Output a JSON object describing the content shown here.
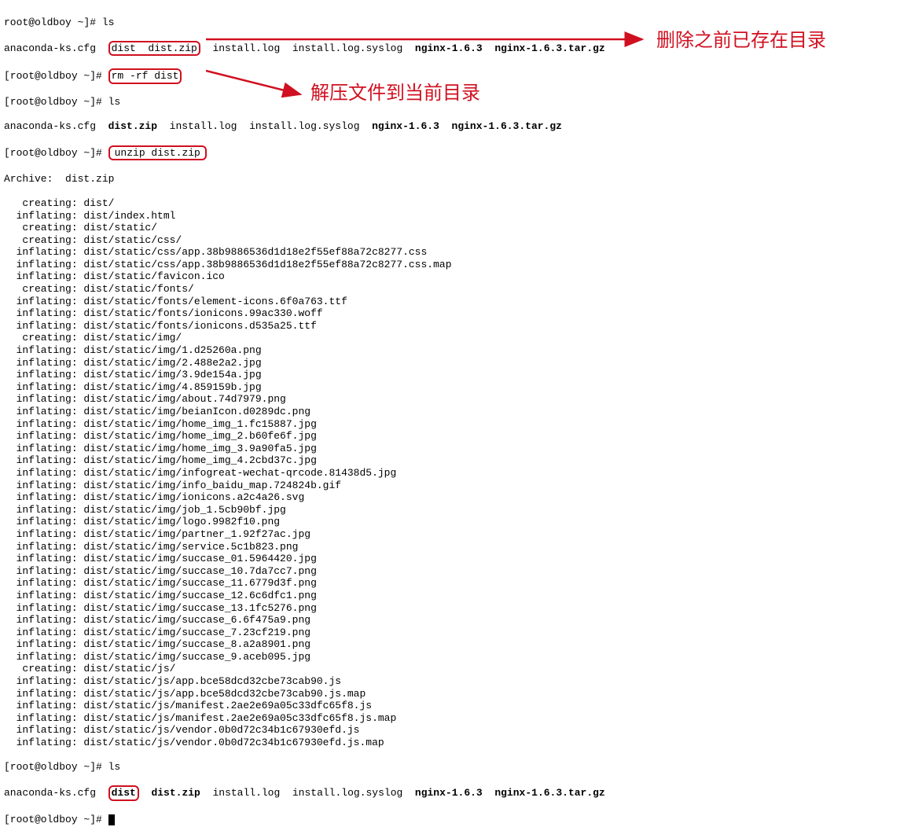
{
  "prompt_title": "root@oldboy ~]# ",
  "prompt": "[root@oldboy ~]# ",
  "cmd_ls1": "ls",
  "cmd_rm": "rm -rf dist",
  "cmd_ls2": "ls",
  "cmd_unzip": "unzip dist.zip",
  "cmd_ls3": "ls",
  "ls_out1": {
    "p1": "anaconda-ks.cfg  ",
    "dist_zip": "dist  dist.zip",
    "p2": "  install.log  install.log.syslog  ",
    "bold1": "nginx-1.6.3",
    "p3": "  ",
    "bold2": "nginx-1.6.3.tar.gz"
  },
  "ls_out2": {
    "p1": "anaconda-ks.cfg  ",
    "dist_zip": "dist.zip",
    "p2": "  install.log  install.log.syslog  ",
    "bold1": "nginx-1.6.3",
    "p3": "  ",
    "bold2": "nginx-1.6.3.tar.gz"
  },
  "ls_out3": {
    "p1": "anaconda-ks.cfg  ",
    "dist_dir": "dist",
    "dist_zip": "  dist.zip",
    "p2": "  install.log  install.log.syslog  ",
    "bold1": "nginx-1.6.3",
    "p3": "  ",
    "bold2": "nginx-1.6.3.tar.gz"
  },
  "archive_line": "Archive:  dist.zip",
  "unzip_lines": [
    "   creating: dist/",
    "  inflating: dist/index.html",
    "   creating: dist/static/",
    "   creating: dist/static/css/",
    "  inflating: dist/static/css/app.38b9886536d1d18e2f55ef88a72c8277.css",
    "  inflating: dist/static/css/app.38b9886536d1d18e2f55ef88a72c8277.css.map",
    "  inflating: dist/static/favicon.ico",
    "   creating: dist/static/fonts/",
    "  inflating: dist/static/fonts/element-icons.6f0a763.ttf",
    "  inflating: dist/static/fonts/ionicons.99ac330.woff",
    "  inflating: dist/static/fonts/ionicons.d535a25.ttf",
    "   creating: dist/static/img/",
    "  inflating: dist/static/img/1.d25260a.png",
    "  inflating: dist/static/img/2.488e2a2.jpg",
    "  inflating: dist/static/img/3.9de154a.jpg",
    "  inflating: dist/static/img/4.859159b.jpg",
    "  inflating: dist/static/img/about.74d7979.png",
    "  inflating: dist/static/img/beianIcon.d0289dc.png",
    "  inflating: dist/static/img/home_img_1.fc15887.jpg",
    "  inflating: dist/static/img/home_img_2.b60fe6f.jpg",
    "  inflating: dist/static/img/home_img_3.9a90fa5.jpg",
    "  inflating: dist/static/img/home_img_4.2cbd37c.jpg",
    "  inflating: dist/static/img/infogreat-wechat-qrcode.81438d5.jpg",
    "  inflating: dist/static/img/info_baidu_map.724824b.gif",
    "  inflating: dist/static/img/ionicons.a2c4a26.svg",
    "  inflating: dist/static/img/job_1.5cb90bf.jpg",
    "  inflating: dist/static/img/logo.9982f10.png",
    "  inflating: dist/static/img/partner_1.92f27ac.jpg",
    "  inflating: dist/static/img/service.5c1b823.png",
    "  inflating: dist/static/img/succase_01.5964420.jpg",
    "  inflating: dist/static/img/succase_10.7da7cc7.png",
    "  inflating: dist/static/img/succase_11.6779d3f.png",
    "  inflating: dist/static/img/succase_12.6c6dfc1.png",
    "  inflating: dist/static/img/succase_13.1fc5276.png",
    "  inflating: dist/static/img/succase_6.6f475a9.png",
    "  inflating: dist/static/img/succase_7.23cf219.png",
    "  inflating: dist/static/img/succase_8.a2a8901.png",
    "  inflating: dist/static/img/succase_9.aceb095.jpg",
    "   creating: dist/static/js/",
    "  inflating: dist/static/js/app.bce58dcd32cbe73cab90.js",
    "  inflating: dist/static/js/app.bce58dcd32cbe73cab90.js.map",
    "  inflating: dist/static/js/manifest.2ae2e69a05c33dfc65f8.js",
    "  inflating: dist/static/js/manifest.2ae2e69a05c33dfc65f8.js.map",
    "  inflating: dist/static/js/vendor.0b0d72c34b1c67930efd.js",
    "  inflating: dist/static/js/vendor.0b0d72c34b1c67930efd.js.map"
  ],
  "annotation1": "删除之前已存在目录",
  "annotation2": "解压文件到当前目录"
}
